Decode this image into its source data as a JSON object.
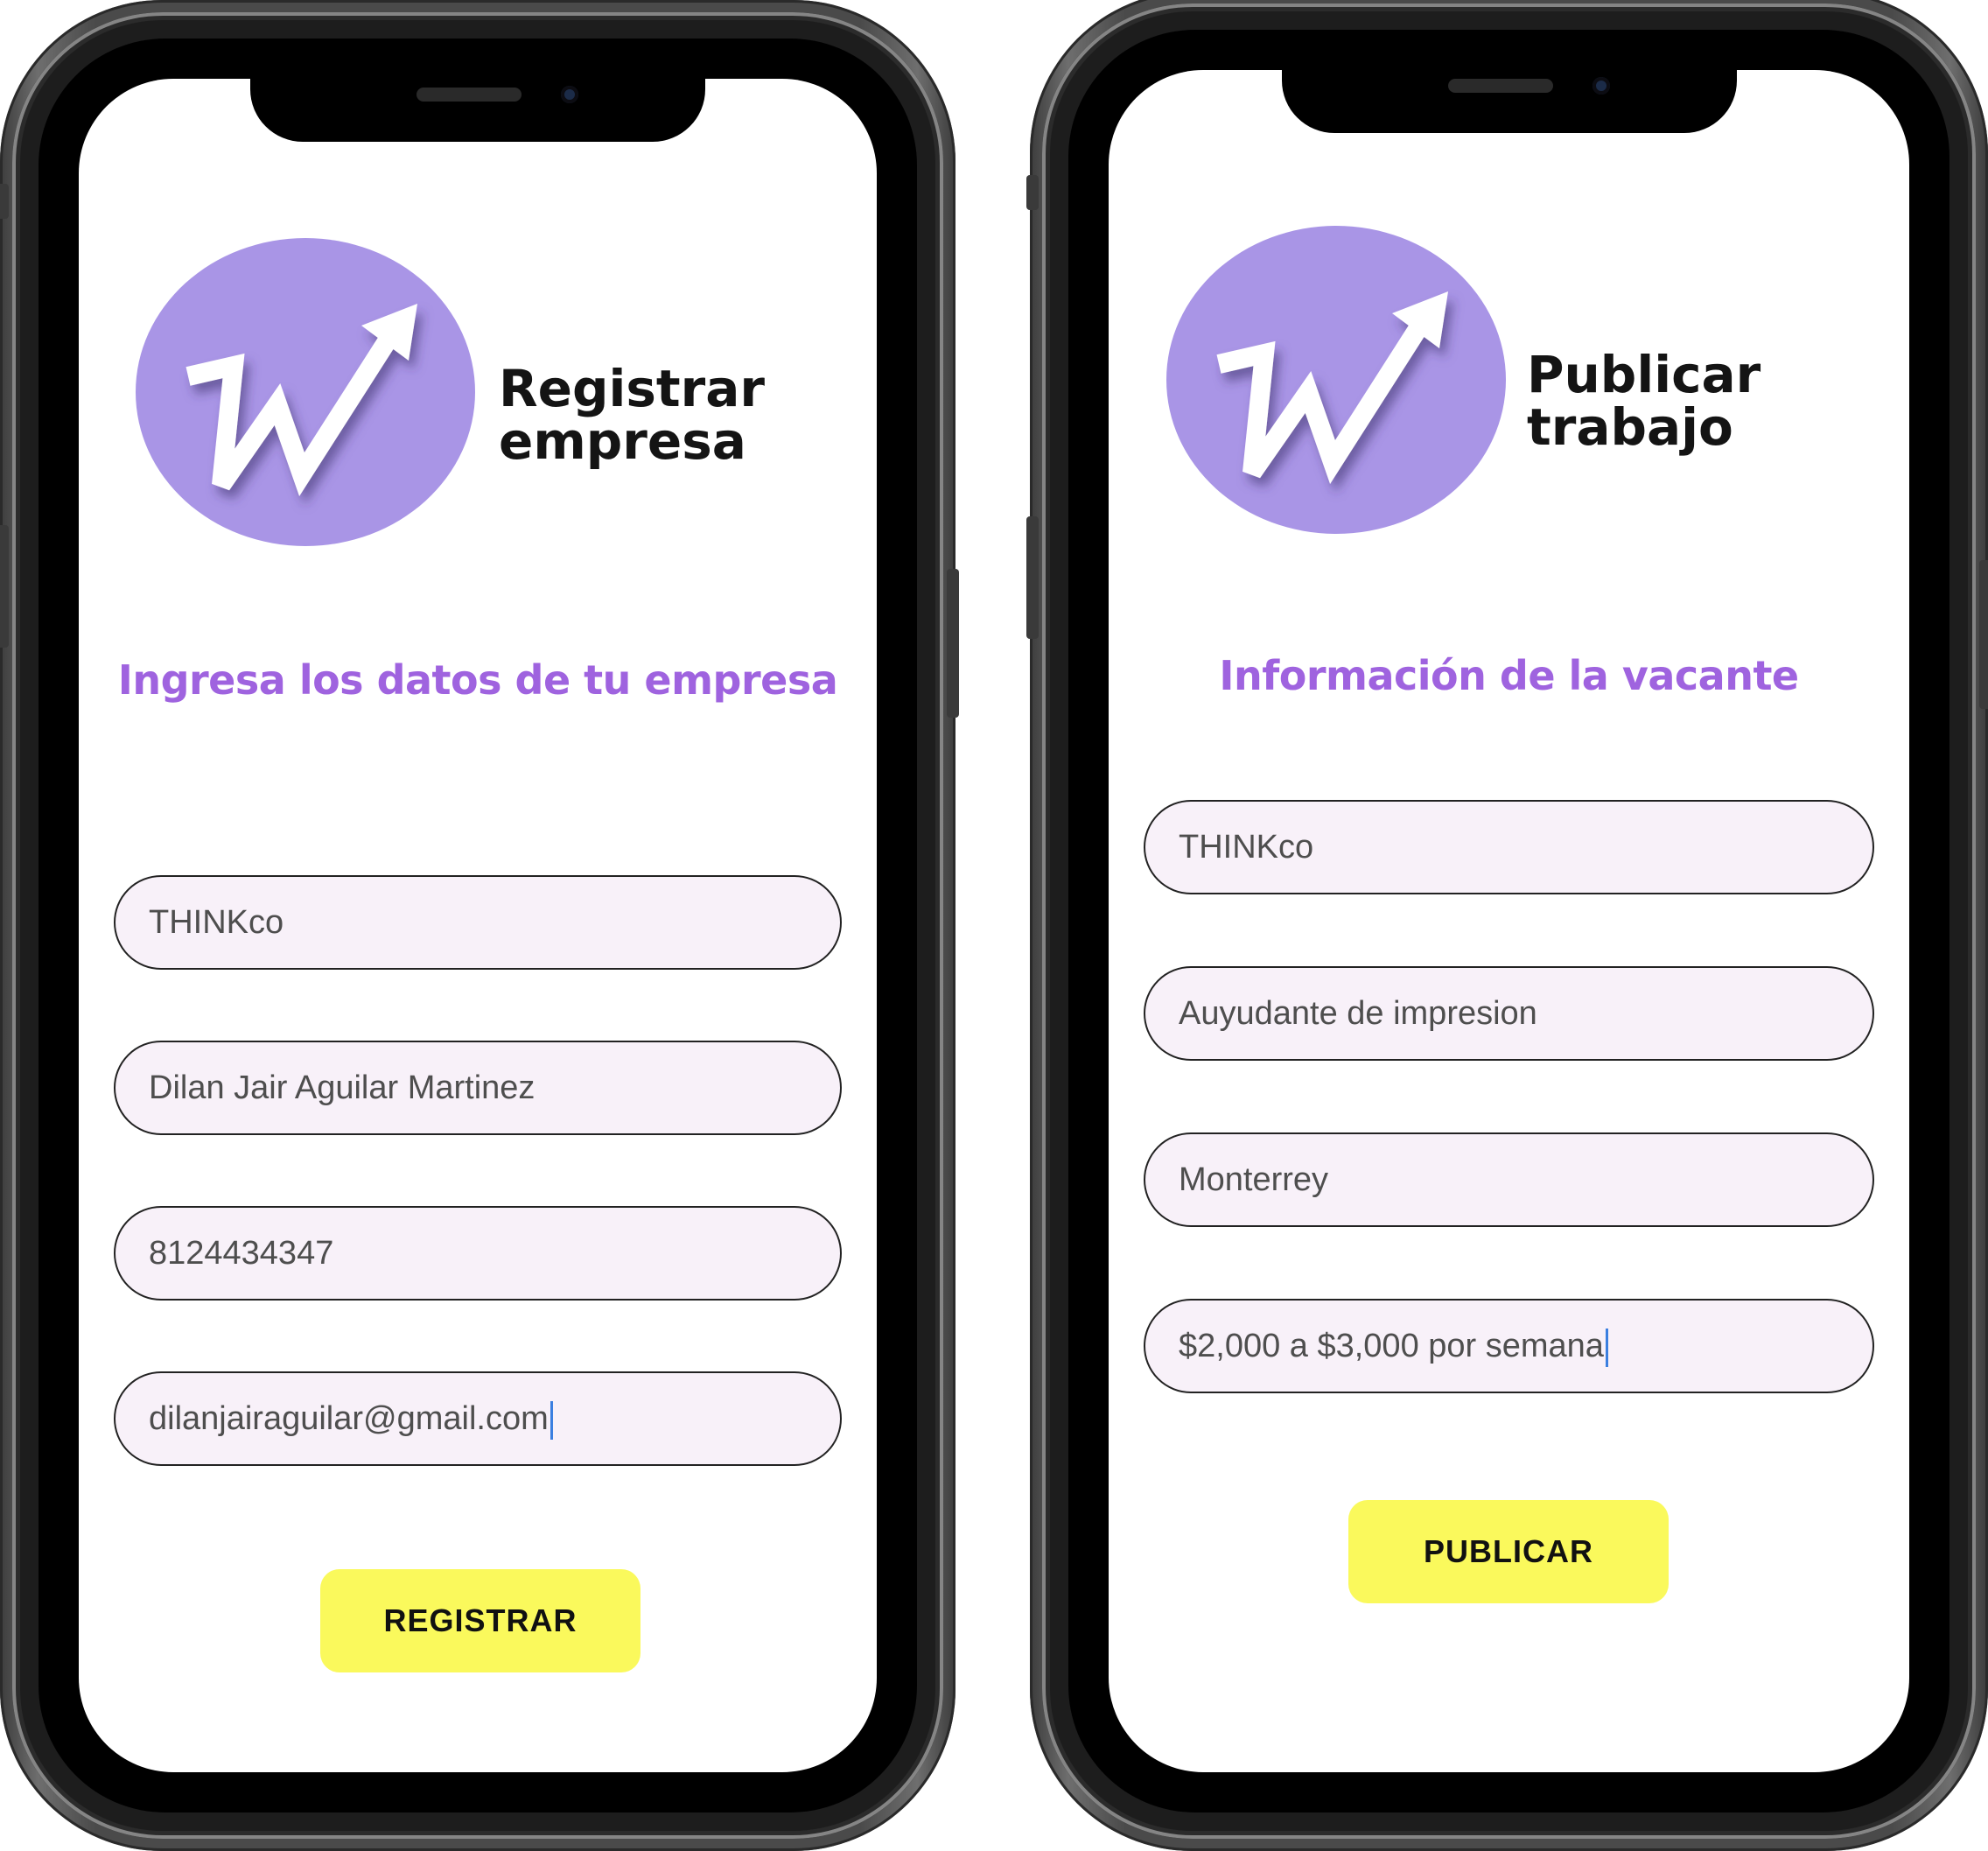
{
  "left_screen": {
    "title_line1": "Registrar",
    "title_line2": "empresa",
    "heading": "Ingresa los datos de tu empresa",
    "fields": [
      "THINKco",
      "Dilan Jair Aguilar Martinez",
      "8124434347",
      "dilanjairaguilar@gmail.com"
    ],
    "button_label": "REGISTRAR"
  },
  "right_screen": {
    "title_line1": "Publicar",
    "title_line2": "trabajo",
    "heading": "Información de la vacante",
    "fields": [
      "THINKco",
      "Auyudante de impresion",
      "Monterrey",
      "$2,000 a $3,000 por semana"
    ],
    "button_label": "PUBLICAR"
  },
  "colors": {
    "logo_purple": "#a995e6",
    "heading_purple": "#9f63df",
    "field_bg": "#f8f1f9",
    "button_yellow": "#faf95c",
    "caret_blue": "#3b7fe0"
  },
  "icons": [
    "w-growth-arrow-logo",
    "front-camera-icon",
    "speaker-grille"
  ]
}
